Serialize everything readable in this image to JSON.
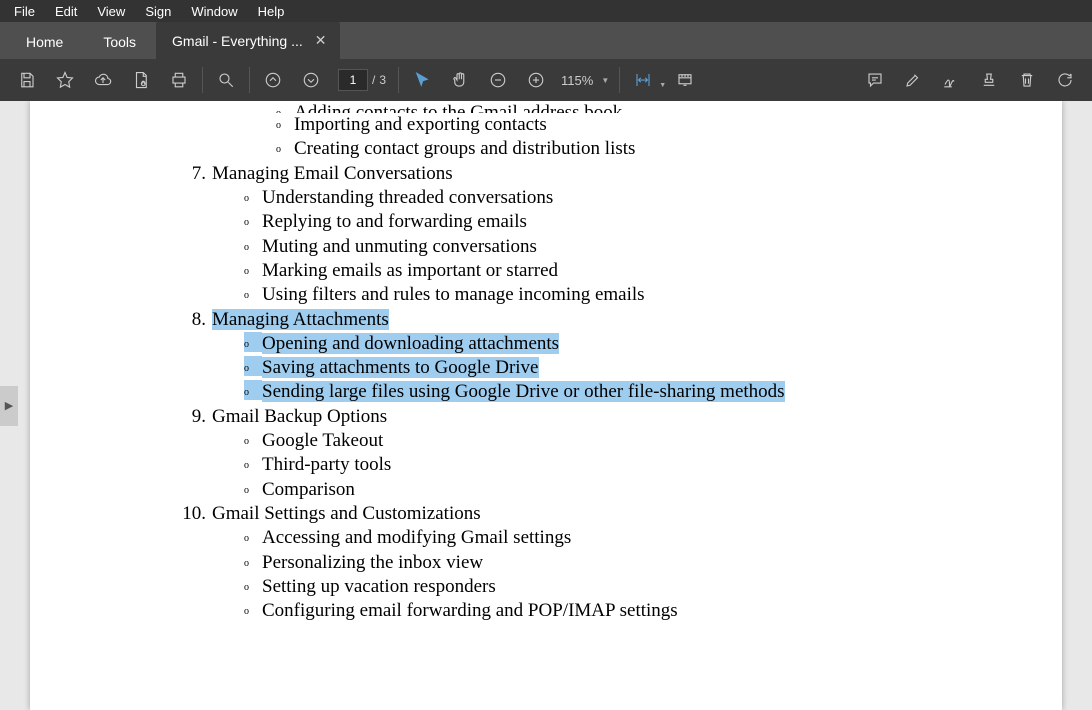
{
  "menubar": {
    "file": "File",
    "edit": "Edit",
    "view": "View",
    "sign": "Sign",
    "window": "Window",
    "help": "Help"
  },
  "tabs": {
    "home": "Home",
    "tools": "Tools",
    "active_title": "Gmail - Everything ..."
  },
  "toolbar": {
    "page_current": "1",
    "page_sep": "/",
    "page_total": "3",
    "zoom_level": "115%"
  },
  "document": {
    "cutoff_line": "Adding contacts to the Gmail address book",
    "orphan_sub_items": [
      "Importing and exporting contacts",
      "Creating contact groups and distribution lists"
    ],
    "sections": [
      {
        "num": "7.",
        "title": "Managing Email Conversations",
        "highlighted": false,
        "items": [
          {
            "text": "Understanding threaded conversations",
            "highlighted": false
          },
          {
            "text": "Replying to and forwarding emails",
            "highlighted": false
          },
          {
            "text": "Muting and unmuting conversations",
            "highlighted": false
          },
          {
            "text": "Marking emails as important or starred",
            "highlighted": false
          },
          {
            "text": "Using filters and rules to manage incoming emails",
            "highlighted": false
          }
        ]
      },
      {
        "num": "8.",
        "title": "Managing Attachments",
        "highlighted": true,
        "items": [
          {
            "text": "Opening and downloading attachments",
            "highlighted": true
          },
          {
            "text": "Saving attachments to Google Drive",
            "highlighted": true
          },
          {
            "text": "Sending large files using Google Drive or other file-sharing methods",
            "highlighted": true
          }
        ]
      },
      {
        "num": "9.",
        "title": "Gmail Backup Options",
        "highlighted": false,
        "items": [
          {
            "text": "Google Takeout",
            "highlighted": false
          },
          {
            "text": "Third-party tools",
            "highlighted": false
          },
          {
            "text": "Comparison",
            "highlighted": false
          }
        ]
      },
      {
        "num": "10.",
        "title": "Gmail Settings and Customizations",
        "highlighted": false,
        "items": [
          {
            "text": "Accessing and modifying Gmail settings",
            "highlighted": false
          },
          {
            "text": "Personalizing the inbox view",
            "highlighted": false
          },
          {
            "text": "Setting up vacation responders",
            "highlighted": false
          },
          {
            "text": "Configuring email forwarding and POP/IMAP settings",
            "highlighted": false
          }
        ]
      }
    ]
  }
}
